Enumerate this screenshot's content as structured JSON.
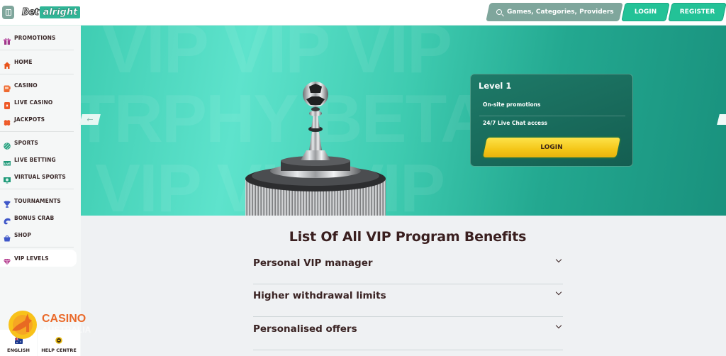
{
  "header": {
    "logo": {
      "part1": "Bet",
      "part2": "alright"
    },
    "search_placeholder": "Games, Categories, Providers",
    "login_label": "LOGIN",
    "register_label": "REGISTER"
  },
  "sidebar": {
    "items": [
      {
        "label": "PROMOTIONS",
        "icon": "gift-icon"
      },
      {
        "label": "HOME",
        "icon": "home-icon"
      },
      {
        "label": "CASINO",
        "icon": "slot-machine-icon"
      },
      {
        "label": "LIVE CASINO",
        "icon": "live-casino-card-icon"
      },
      {
        "label": "JACKPOTS",
        "icon": "clover-icon"
      },
      {
        "label": "SPORTS",
        "icon": "sports-ball-icon"
      },
      {
        "label": "LIVE BETTING",
        "icon": "live-badge-icon"
      },
      {
        "label": "VIRTUAL SPORTS",
        "icon": "virtual-monitor-icon"
      },
      {
        "label": "TOURNAMENTS",
        "icon": "trophy-icon"
      },
      {
        "label": "BONUS CRAB",
        "icon": "crab-claw-icon"
      },
      {
        "label": "SHOP",
        "icon": "shopping-basket-icon"
      },
      {
        "label": "VIP LEVELS",
        "icon": "diamond-icon",
        "active": true
      }
    ],
    "footer": {
      "language_label": "ENGLISH",
      "help_label": "HELP CENTRE"
    }
  },
  "banner": {
    "watermark_rows": [
      "VIP VIP VIP",
      "TRPHY BETA",
      "VIP VIP VIP"
    ],
    "level_card": {
      "title": "Level 1",
      "benefits": [
        "On-site promotions",
        "24/7 Live Chat access"
      ],
      "login_label": "LOGIN"
    }
  },
  "benefits": {
    "title": "List Of All VIP Program Benefits",
    "items": [
      {
        "label": "Personal VIP manager",
        "expanded": false
      },
      {
        "label": "Higher withdrawal limits",
        "expanded": false
      },
      {
        "label": "Personalised offers",
        "expanded": false
      }
    ]
  },
  "overlay_watermark": {
    "line1": "CASINO",
    "line2": "AUSTRALIA"
  },
  "colors": {
    "brand_green": "#23c297",
    "search_bg": "#7fa69c",
    "banner_teal": "#3ecbb0",
    "card_dark": "#145e51",
    "cta_yellow": "#f4c618",
    "heading_brown": "#3a1f1f"
  }
}
